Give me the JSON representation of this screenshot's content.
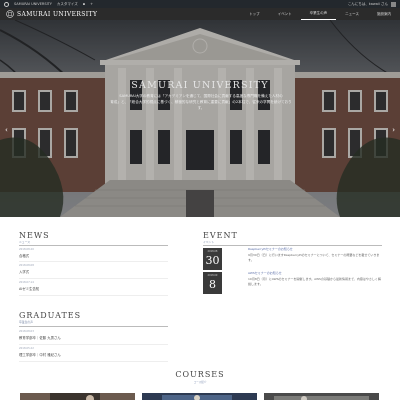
{
  "admin_bar": {
    "site_label": "SAMURAI UNIVERSITY",
    "customize_label": "カスタマイズ",
    "greeting": "こんにちは、kawaii さん"
  },
  "site": {
    "title": "SAMURAI UNIVERSITY"
  },
  "nav": {
    "items": [
      "トップ",
      "イベント",
      "卒業生の声",
      "ニュース",
      "施設案内"
    ]
  },
  "hero": {
    "title": "SAMURAI UNIVERSITY",
    "text_line1": "SAMURAI大学の教育には「アカデミアンを通じて、国際社会に貢献する高度な専門職を備えた人材の",
    "text_line2": "育成」と、「総合大学的視点に基づく、積極的な研究と教育に重要に貢献」の2本柱で、従来の学問を続けておりす。",
    "prev_icon": "chevron-left-icon",
    "next_icon": "chevron-right-icon"
  },
  "news": {
    "title": "NEWS",
    "subtitle": "ニュース",
    "items": [
      {
        "date": "2018.08.20",
        "text": "合格式"
      },
      {
        "date": "2018.08.08",
        "text": "入学式"
      },
      {
        "date": "2018.07.14",
        "text": "AIゼミ生告知"
      }
    ]
  },
  "event": {
    "title": "EVENT",
    "subtitle": "イベント",
    "items": [
      {
        "month": "2018.08",
        "day": "30",
        "title": "RaspberryPiセミナーのお知らせ",
        "body": "9月30日（日）に行いますRaspberryPiのセミナーについて、セミナーの概要などを載せていきます。"
      },
      {
        "month": "2018.09",
        "day": "8",
        "title": "AWSセミナーのお知らせ",
        "body": "10月8日（月）にAWSのセミナーを開催します。AWSの基礎から最新情報まで、内容はやさしく解説します。"
      }
    ]
  },
  "graduates": {
    "title": "GRADUATES",
    "subtitle": "卒業生の声",
    "items": [
      {
        "date": "2018.08.03",
        "text": "教育学部卒｜佐藤 九男さん"
      },
      {
        "date": "2018.05.22",
        "text": "理工学部卒｜中村 雅紀さん"
      }
    ]
  },
  "courses": {
    "title": "COURSES",
    "subtitle": "コース紹介"
  },
  "colors": {
    "admin_bar": "#23282d",
    "site_bar": "#2b2b2b",
    "accent_blue": "#5a6ea8",
    "date_box": "#3a3a3a"
  }
}
